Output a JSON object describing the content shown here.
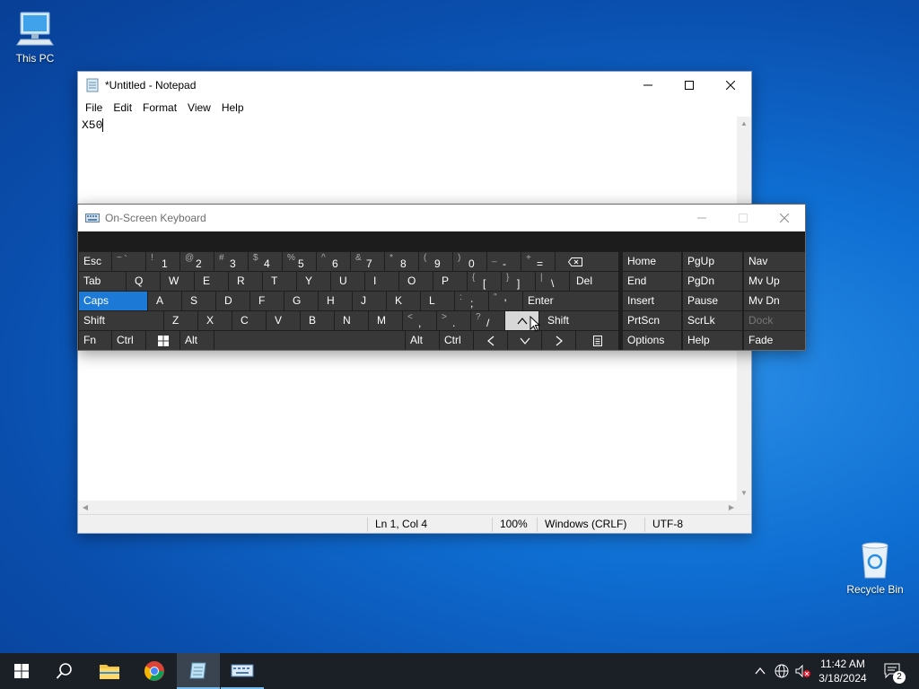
{
  "desktop": {
    "icons": [
      {
        "label": "This PC"
      },
      {
        "label": "Recycle Bin"
      }
    ]
  },
  "notepad": {
    "title": "*Untitled - Notepad",
    "menu": [
      "File",
      "Edit",
      "Format",
      "View",
      "Help"
    ],
    "content": "X50",
    "status": {
      "position": "Ln 1, Col 4",
      "zoom": "100%",
      "line_ending": "Windows (CRLF)",
      "encoding": "UTF-8"
    }
  },
  "osk": {
    "title": "On-Screen Keyboard",
    "rows": {
      "r1": [
        {
          "main": "Esc"
        },
        {
          "sub": "~",
          "main": "`"
        },
        {
          "sub": "!",
          "main": "1"
        },
        {
          "sub": "@",
          "main": "2"
        },
        {
          "sub": "#",
          "main": "3"
        },
        {
          "sub": "$",
          "main": "4"
        },
        {
          "sub": "%",
          "main": "5"
        },
        {
          "sub": "^",
          "main": "6"
        },
        {
          "sub": "&",
          "main": "7"
        },
        {
          "sub": "*",
          "main": "8"
        },
        {
          "sub": "(",
          "main": "9"
        },
        {
          "sub": ")",
          "main": "0"
        },
        {
          "sub": "_",
          "main": "-"
        },
        {
          "sub": "+",
          "main": "="
        }
      ],
      "r2": [
        "Tab",
        "Q",
        "W",
        "E",
        "R",
        "T",
        "Y",
        "U",
        "I",
        "O",
        "P",
        "Del"
      ],
      "r2_sym": [
        {
          "sub": "{",
          "main": "["
        },
        {
          "sub": "}",
          "main": "]"
        },
        {
          "sub": "|",
          "main": "\\"
        }
      ],
      "r3": [
        "Caps",
        "A",
        "S",
        "D",
        "F",
        "G",
        "H",
        "J",
        "K",
        "L",
        "Enter"
      ],
      "r3_sym": [
        {
          "sub": ":",
          "main": ";"
        },
        {
          "sub": "\"",
          "main": "'"
        }
      ],
      "r4": [
        "Shift",
        "Z",
        "X",
        "C",
        "V",
        "B",
        "N",
        "M",
        "Shift"
      ],
      "r4_sym": [
        {
          "sub": "<",
          "main": ","
        },
        {
          "sub": ">",
          "main": "."
        },
        {
          "sub": "?",
          "main": "/"
        }
      ],
      "r5": [
        "Fn",
        "Ctrl",
        "Alt",
        "Alt",
        "Ctrl"
      ]
    },
    "nav": [
      "Home",
      "PgUp",
      "Nav",
      "End",
      "PgDn",
      "Mv Up",
      "Insert",
      "Pause",
      "Mv Dn",
      "PrtScn",
      "ScrLk",
      "Dock",
      "Options",
      "Help",
      "Fade"
    ]
  },
  "taskbar": {
    "time": "11:42 AM",
    "date": "3/18/2024",
    "notification_count": "2"
  }
}
